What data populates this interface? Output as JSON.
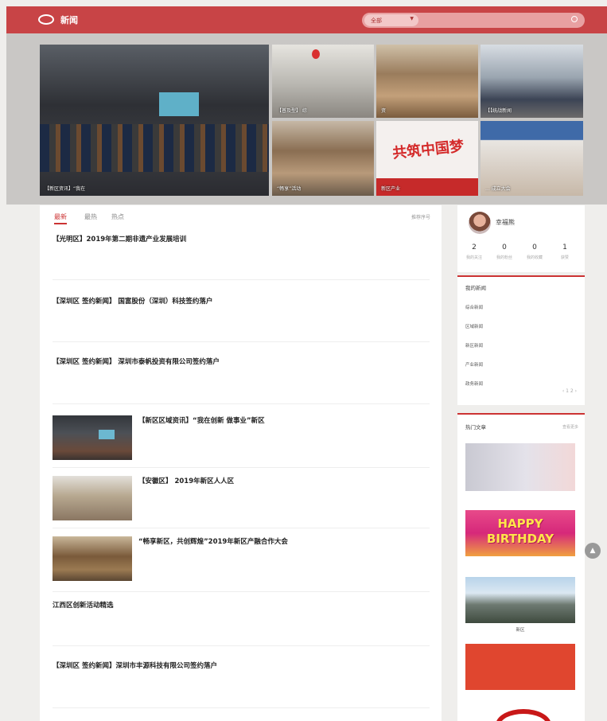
{
  "header": {
    "site_name": "新闻",
    "search": {
      "category": "全部",
      "placeholder": ""
    }
  },
  "banner": {
    "slides": [
      {
        "caption": "【新区资讯】“我在"
      },
      {
        "caption": "【普及型】 综"
      },
      {
        "caption": "资"
      },
      {
        "caption": "【【统战新闻"
      },
      {
        "caption": "“畅享”活动"
      },
      {
        "caption": "新区产业",
        "text": "共筑中国梦"
      },
      {
        "caption": "... 成立大会"
      }
    ]
  },
  "feed": {
    "tabs": [
      "最新",
      "最热",
      "热点"
    ],
    "tip": "推荐序号",
    "articles": [
      {
        "title": "【光明区】2019年第二期非遗产业发展培训",
        "summary": "",
        "meta": "",
        "stats": ""
      },
      {
        "title": "【深圳区 签约新闻】 国富股份（深圳）科技签约落户",
        "summary": "",
        "meta": "",
        "stats": ""
      },
      {
        "title": "【深圳区 签约新闻】 深圳市泰帆投资有限公司签约落户",
        "summary": "",
        "meta": "",
        "stats": ""
      },
      {
        "title": "【新区区域资讯】“我在创新 做事业”新区",
        "summary": "",
        "meta": "",
        "stats": ""
      },
      {
        "title": "【安徽区】 2019年新区人人区",
        "summary": "",
        "meta": "",
        "stats": ""
      },
      {
        "title": "“畅享新区，共创辉煌”2019年新区产融合作大会",
        "summary": "",
        "meta": "",
        "stats": ""
      },
      {
        "title": "江西区创新活动精选",
        "summary": "",
        "meta": "",
        "stats": ""
      },
      {
        "title": "【深圳区 签约新闻】深圳市丰源科技有限公司签约落户",
        "summary": "",
        "meta": "",
        "stats": ""
      }
    ]
  },
  "profile": {
    "name": "幸福熊",
    "stats": [
      {
        "num": "2",
        "label": "我的关注"
      },
      {
        "num": "0",
        "label": "我的粉丝"
      },
      {
        "num": "0",
        "label": "我的收藏"
      },
      {
        "num": "1",
        "label": "获赞"
      }
    ]
  },
  "categories": {
    "title": "我的新闻",
    "items": [
      "综合新闻",
      "区域新闻",
      "新区新闻",
      "产业新闻",
      "政务新闻"
    ],
    "pager": "‹ 1 2 ›"
  },
  "hot": {
    "title": "热门文章",
    "more": "查看更多",
    "items": [
      {
        "caption": "",
        "img_text": ""
      },
      {
        "caption": "",
        "img_text": "HAPPY BIRTHDAY"
      },
      {
        "caption": "新区",
        "img_text": ""
      },
      {
        "caption": "",
        "img_text": ""
      }
    ]
  },
  "scroll_top_icon": "up-arrow"
}
